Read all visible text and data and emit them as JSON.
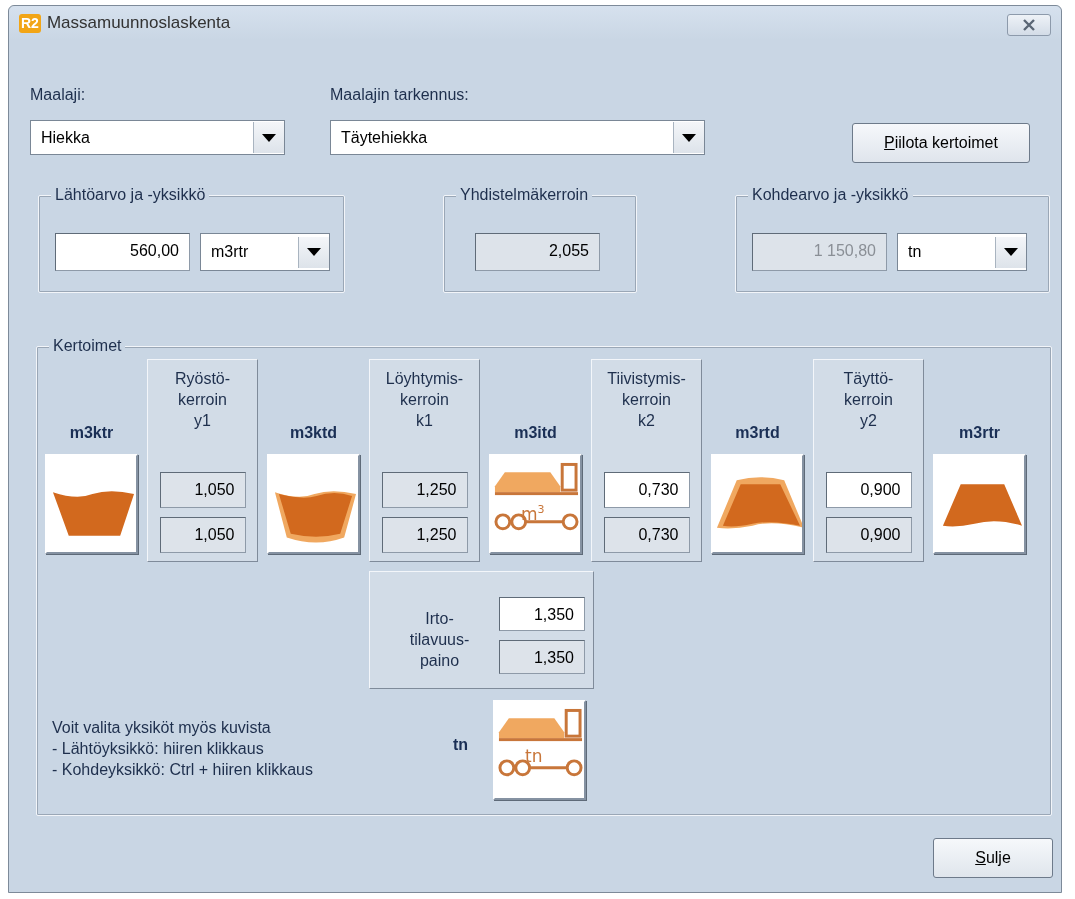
{
  "window": {
    "badge": "R2",
    "title": "Massamuunnoslaskenta"
  },
  "soil": {
    "label": "Maalaji:",
    "value": "Hiekka"
  },
  "soil_detail": {
    "label": "Maalajin tarkennus:",
    "value": "Täytehiekka"
  },
  "toggle_button": {
    "label": "Piilota kertoimet"
  },
  "groups": [
    {
      "title": "Lähtöarvo ja -yksikkö",
      "field": {
        "value": "560,00",
        "readonly": false,
        "disabled": false
      },
      "unit": "m3rtr"
    },
    {
      "title": "Yhdistelmäkerroin",
      "field": {
        "value": "2,055",
        "readonly": true,
        "disabled": false
      }
    },
    {
      "title": "Kohdearvo ja -yksikkö",
      "field": {
        "value": "1 150,80",
        "readonly": true,
        "disabled": true
      },
      "unit": "tn"
    }
  ],
  "factors": {
    "title": "Kertoimet",
    "items": [
      {
        "kind": "unit",
        "label": "m3ktr"
      },
      {
        "kind": "factor",
        "label": [
          "Ryöstö-",
          "kerroin",
          "y1"
        ],
        "fields": [
          {
            "value": "1,050",
            "readonly": true
          },
          {
            "value": "1,050",
            "readonly": true
          }
        ]
      },
      {
        "kind": "unit",
        "label": "m3ktd"
      },
      {
        "kind": "factor",
        "label": [
          "Löyhtymis-",
          "kerroin",
          "k1"
        ],
        "fields": [
          {
            "value": "1,250",
            "readonly": true
          },
          {
            "value": "1,250",
            "readonly": true
          }
        ]
      },
      {
        "kind": "unit",
        "label": "m3itd",
        "truck_text": "m$^{3}$"
      },
      {
        "kind": "factor",
        "label": [
          "Tiivistymis-",
          "kerroin",
          "k2"
        ],
        "fields": [
          {
            "value": "0,730",
            "readonly": false
          },
          {
            "value": "0,730",
            "readonly": true
          }
        ]
      },
      {
        "kind": "unit",
        "label": "m3rtd"
      },
      {
        "kind": "factor",
        "label": [
          "Täyttö-",
          "kerroin",
          "y2"
        ],
        "fields": [
          {
            "value": "0,900",
            "readonly": false
          },
          {
            "value": "0,900",
            "readonly": true
          }
        ]
      },
      {
        "kind": "unit",
        "label": "m3rtr"
      }
    ],
    "density": {
      "label": [
        "Irto-",
        "tilavuus-",
        "paino"
      ],
      "fields": [
        {
          "value": "1,350",
          "readonly": false
        },
        {
          "value": "1,350",
          "readonly": true
        }
      ]
    },
    "hint": [
      "Voit valita yksiköt myös kuvista",
      "- Lähtöyksikkö: hiiren klikkaus",
      "- Kohdeyksikkö: Ctrl + hiiren klikkaus"
    ],
    "target_unit": {
      "label": "tn",
      "truck_text": "tn"
    }
  },
  "close_button": {
    "label": "Sulje"
  }
}
